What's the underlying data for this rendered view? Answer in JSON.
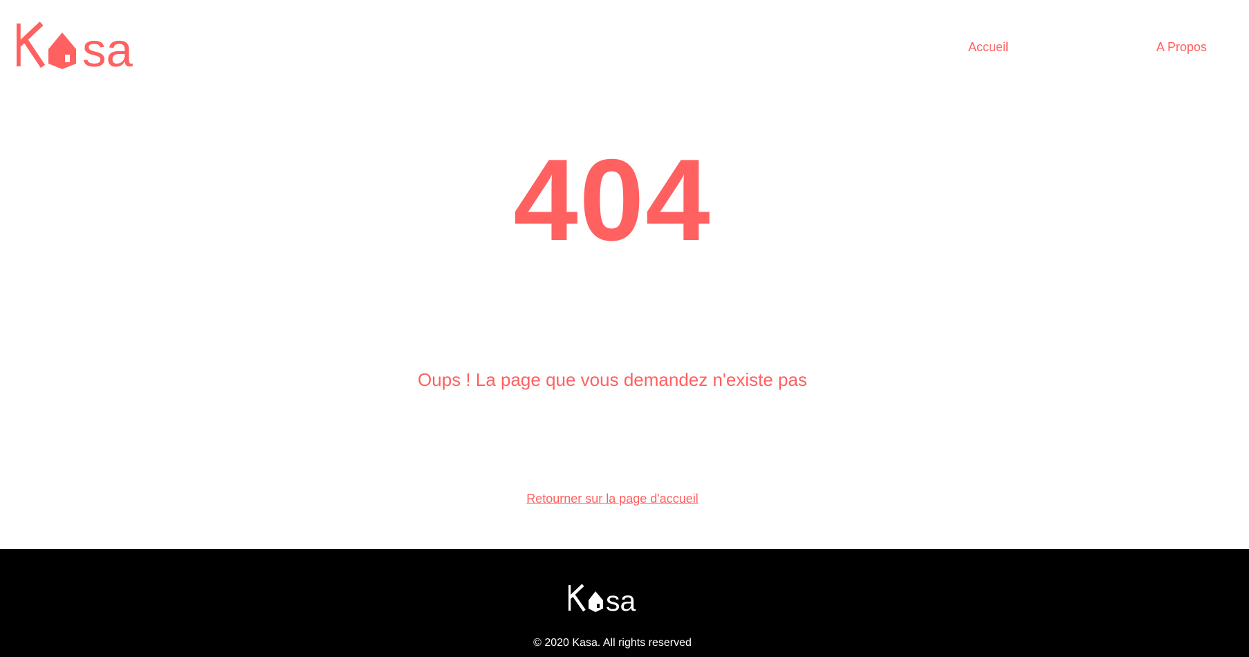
{
  "brand": {
    "name": "Kasa",
    "color": "#FF6060"
  },
  "nav": {
    "home": "Accueil",
    "about": "A Propos"
  },
  "error": {
    "code": "404",
    "message": "Oups ! La page que vous demandez n'existe pas",
    "back_link": "Retourner sur la page d'accueil"
  },
  "footer": {
    "copyright": "© 2020 Kasa. All rights reserved"
  },
  "icons": {
    "logo_house": "house-icon"
  }
}
